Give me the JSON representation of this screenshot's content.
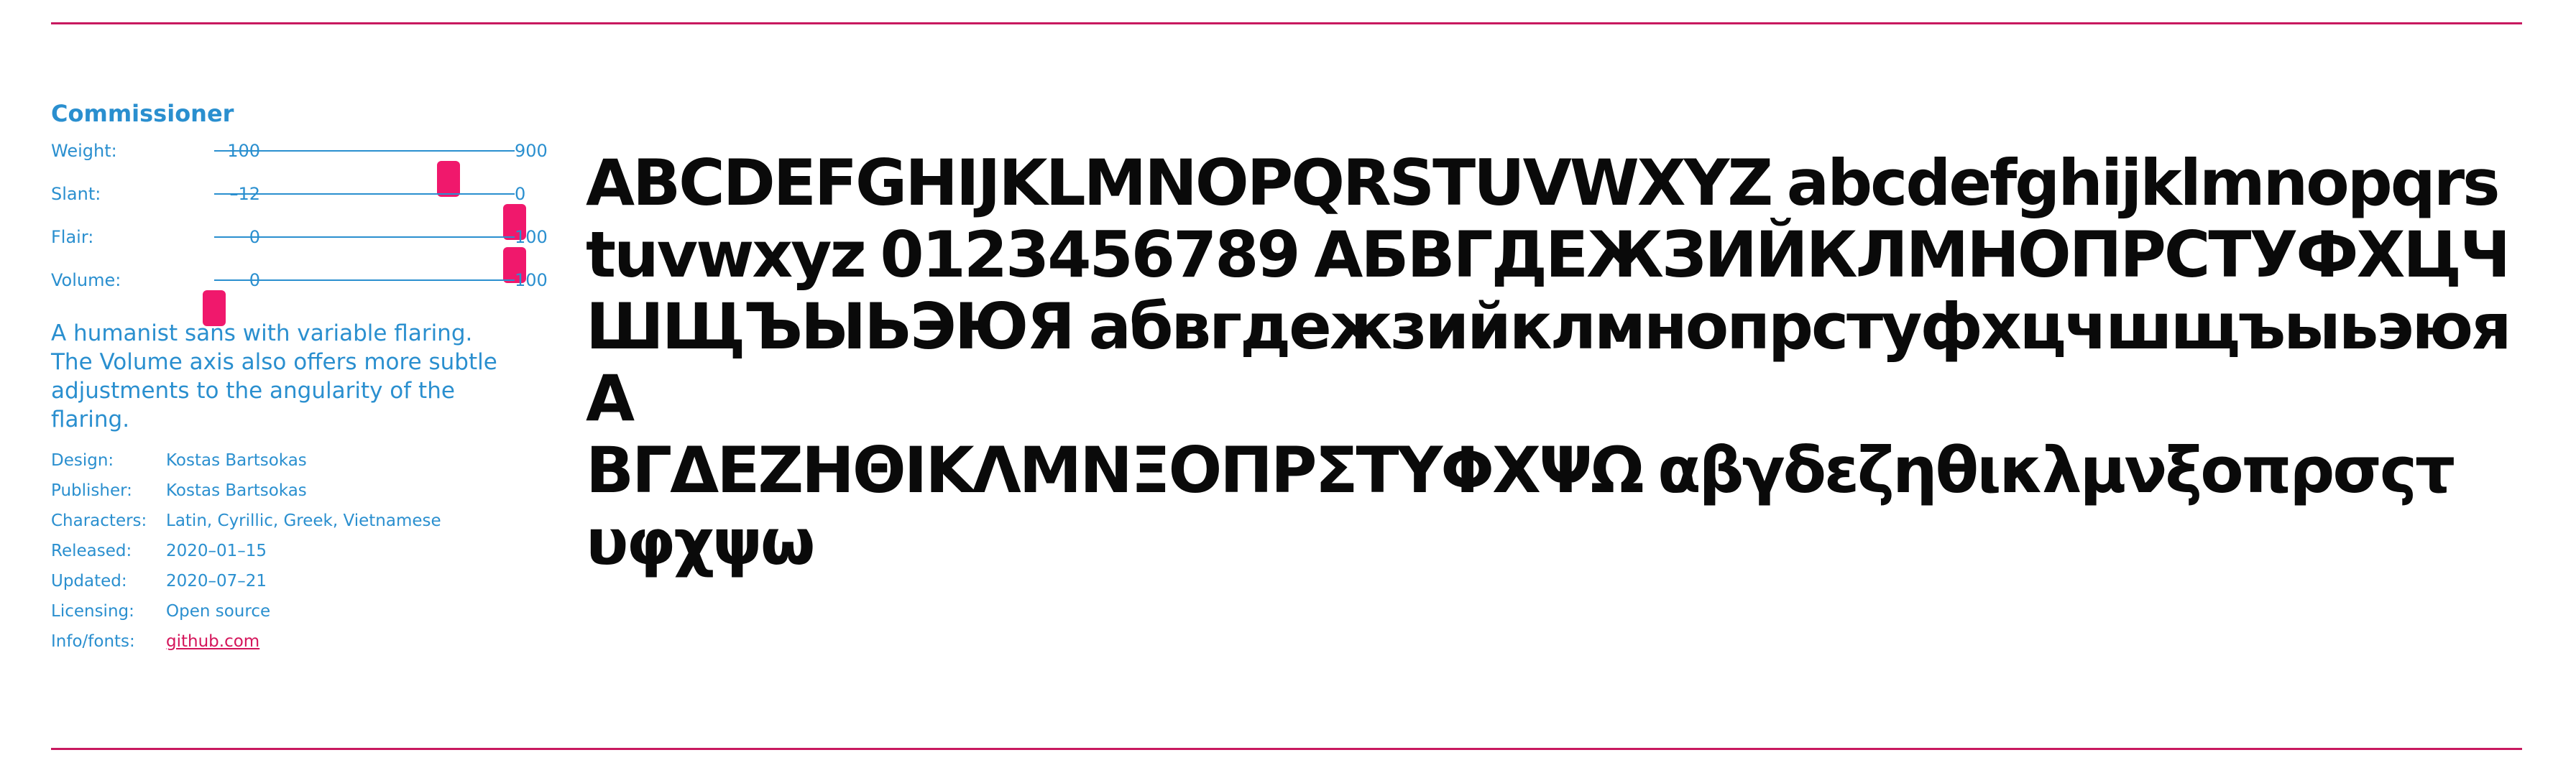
{
  "font": {
    "name": "Commissioner",
    "axes": [
      {
        "label": "Weight:",
        "min": "100",
        "max": "900",
        "value_fraction": 0.78
      },
      {
        "label": "Slant:",
        "min": "–12",
        "max": "0",
        "value_fraction": 1.0
      },
      {
        "label": "Flair:",
        "min": "0",
        "max": "100",
        "value_fraction": 1.0
      },
      {
        "label": "Volume:",
        "min": "0",
        "max": "100",
        "value_fraction": 0.0
      }
    ],
    "description": "A humanist sans with variable flaring. The Volume axis also offers more subtle adjustments to the angularity of the flaring.",
    "meta": [
      {
        "key": "Design:",
        "value": "Kostas Bartsokas"
      },
      {
        "key": "Publisher:",
        "value": "Kostas Bartsokas"
      },
      {
        "key": "Characters:",
        "value": "Latin, Cyrillic, Greek, Vietnamese"
      },
      {
        "key": "Released:",
        "value": "2020–01–15"
      },
      {
        "key": "Updated:",
        "value": "2020–07–21"
      },
      {
        "key": "Licensing:",
        "value": "Open source"
      },
      {
        "key": "Info/fonts:",
        "value": "github.com",
        "link": true
      }
    ]
  },
  "specimen": {
    "lines": [
      "ABCDEFGHIJKLMNOPQRSTUVWXYZ abcdefghijklmnopqrs",
      "tuvwxyz 0123456789 АБВГДЕЖЗИЙКЛМНОПРСТУФХЦЧ",
      "ШЩЪЫЬЭЮЯ абвгдежзийклмнопрстуфхцчшщъыьэюя Α",
      "ΒΓΔΕΖΗΘΙΚΛΜΝΞΟΠΡΣΤΥΦΧΨΩ αβγδεζηθικλμνξοπρσςτ",
      "υφχψω"
    ]
  },
  "colors": {
    "accent": "#2a8fcf",
    "thumb": "#f0186c",
    "rule": "#c8195f",
    "link": "#d4145a",
    "text": "#0a0a0a"
  }
}
